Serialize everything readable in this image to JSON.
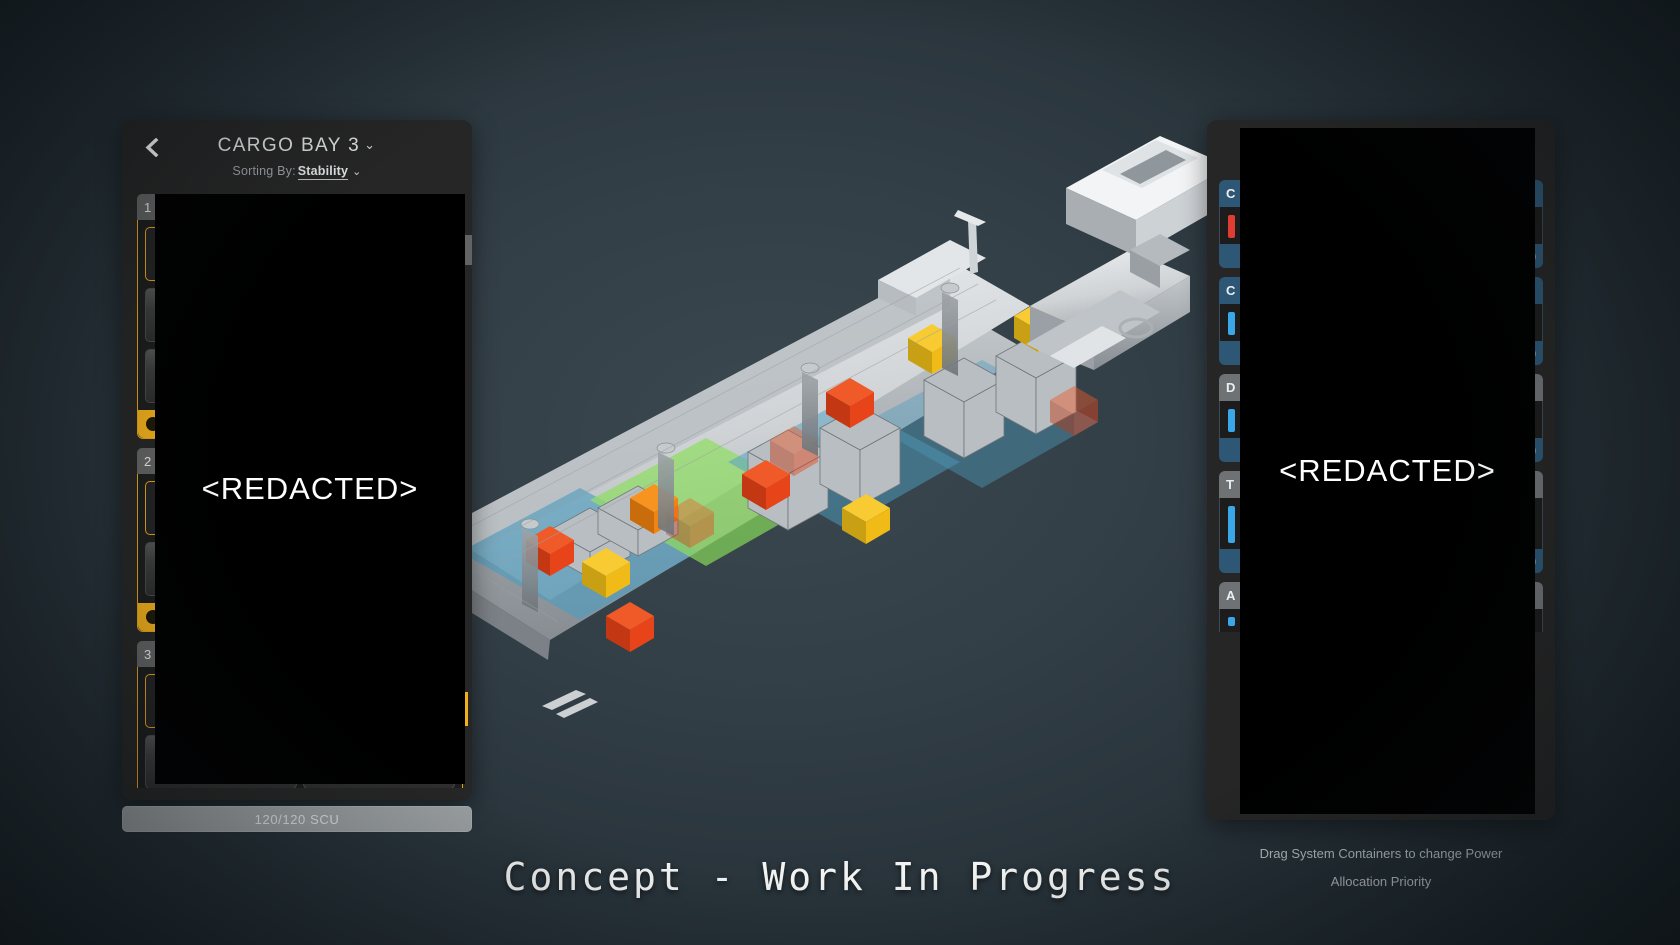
{
  "background": {
    "accent_slate": "#333f47",
    "panel_bg": "#262626",
    "cargo_accent": "#f2b01c",
    "power_accent": "#2d5775"
  },
  "cargo_panel": {
    "back_icon": "chevron-left-icon",
    "title": "CARGO BAY 3",
    "title_chevron": "⌄",
    "sorting_label": "Sorting By:",
    "sorting_value": "Stability",
    "sorting_chevron": "⌄",
    "capacity_label": "120/120 SCU",
    "redaction_text": "<REDACTED>",
    "groups": [
      {
        "tag": "1",
        "footer_label": "",
        "slots": [
          [
            "empty",
            "filled"
          ],
          [
            "filled",
            "filled"
          ],
          [
            "filled",
            "filled"
          ]
        ]
      },
      {
        "tag": "2",
        "footer_label": "",
        "slots": [
          [
            "empty",
            "filled"
          ],
          [
            "filled",
            "filled"
          ]
        ]
      },
      {
        "tag": "3",
        "footer_label": "",
        "slots": [
          [
            "empty",
            "filled"
          ]
        ]
      }
    ],
    "scroll_up_icon": "chevron-up-icon"
  },
  "power_panel": {
    "redaction_text": "<REDACTED>",
    "caption_line1": "Drag System Containers to change Power",
    "caption_line2": "Allocation Priority",
    "cards": [
      {
        "head_letter": "C",
        "head_right": "]",
        "head_style": "blue",
        "meter_color": "#e03c31",
        "foot_right": ")",
        "foot_style": "blue"
      },
      {
        "head_letter": "C",
        "head_right": "]",
        "head_style": "blue",
        "meter_color": "#39a7e8",
        "foot_right": ")",
        "foot_style": "blue"
      },
      {
        "head_letter": "D",
        "head_right": "]",
        "head_style": "gray",
        "meter_color": "#39a7e8",
        "foot_right": ")",
        "foot_style": "blue"
      },
      {
        "head_letter": "T",
        "head_right": "]",
        "head_style": "gray",
        "meter_color": "#39a7e8",
        "foot_right": ")",
        "foot_style": "blue"
      },
      {
        "head_letter": "A",
        "head_right": "]",
        "head_style": "gray",
        "meter_color": "#39a7e8",
        "foot_right": ")",
        "foot_style": "blue"
      }
    ]
  },
  "footer": {
    "wip_caption": "Concept - Work In Progress"
  },
  "ship_render": {
    "description": "3D cargo ship cutaway with colored cargo containers",
    "hull_color": "#d7dadc",
    "hull_shadow": "#8e9498",
    "zone_green": "#8ae05a",
    "zone_blue": "#4f9ec0",
    "container_colors": [
      "#e8441a",
      "#f08a18",
      "#f5c518",
      "#c9cdd0"
    ]
  }
}
